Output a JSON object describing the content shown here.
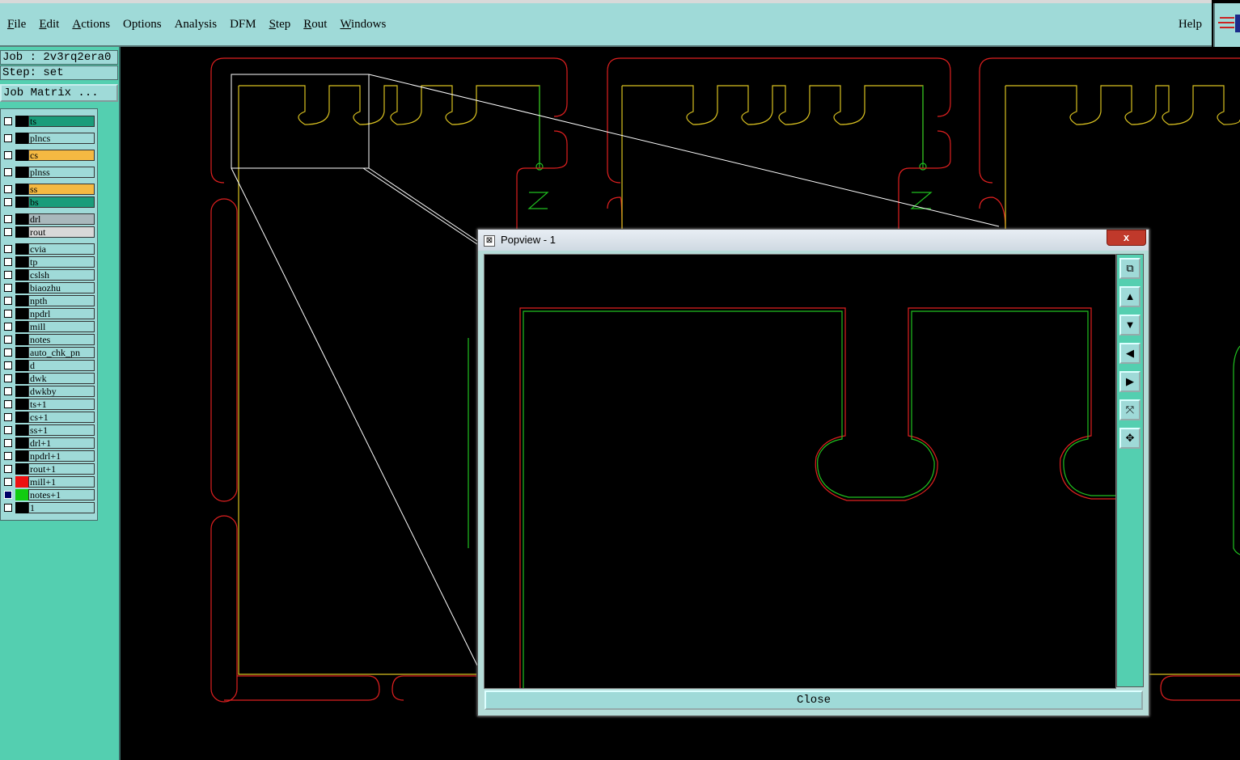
{
  "menu": {
    "items": [
      "File",
      "Edit",
      "Actions",
      "Options",
      "Analysis",
      "DFM",
      "Step",
      "Rout",
      "Windows"
    ],
    "help": "Help"
  },
  "job": {
    "label": "Job : 2v3rq2era0",
    "step": "Step: set",
    "matrix_button": "Job Matrix ..."
  },
  "layers": [
    {
      "name": "ts",
      "color": "#1a9c7a"
    },
    {
      "name": "plncs",
      "color": "#9fdad8"
    },
    {
      "name": "cs",
      "color": "#f5b942"
    },
    {
      "name": "plnss",
      "color": "#9fdad8"
    },
    {
      "name": "ss",
      "color": "#f5b942"
    },
    {
      "name": "bs",
      "color": "#1a9c7a"
    },
    {
      "name": "drl",
      "color": "#a9b8bc"
    },
    {
      "name": "rout",
      "color": "#d8d8d8"
    },
    {
      "name": "cvia",
      "color": "#9fdad8"
    },
    {
      "name": "tp",
      "color": "#9fdad8"
    },
    {
      "name": "cslsh",
      "color": "#9fdad8"
    },
    {
      "name": "biaozhu",
      "color": "#9fdad8"
    },
    {
      "name": "npth",
      "color": "#9fdad8"
    },
    {
      "name": "npdrl",
      "color": "#9fdad8"
    },
    {
      "name": "mill",
      "color": "#9fdad8"
    },
    {
      "name": "notes",
      "color": "#9fdad8"
    },
    {
      "name": "auto_chk_pn",
      "color": "#9fdad8"
    },
    {
      "name": "d",
      "color": "#9fdad8"
    },
    {
      "name": "dwk",
      "color": "#9fdad8"
    },
    {
      "name": "dwkby",
      "color": "#9fdad8"
    },
    {
      "name": "ts+1",
      "color": "#9fdad8"
    },
    {
      "name": "cs+1",
      "color": "#9fdad8"
    },
    {
      "name": "ss+1",
      "color": "#9fdad8"
    },
    {
      "name": "drl+1",
      "color": "#9fdad8"
    },
    {
      "name": "npdrl+1",
      "color": "#9fdad8"
    },
    {
      "name": "rout+1",
      "color": "#9fdad8"
    },
    {
      "name": "mill+1",
      "color": "#9fdad8",
      "swatch": "#e11"
    },
    {
      "name": "notes+1",
      "color": "#9fdad8",
      "swatch": "#1c1",
      "selected": true
    },
    {
      "name": "1",
      "color": "#9fdad8"
    }
  ],
  "popview": {
    "title": "Popview - 1",
    "close_label": "Close",
    "close_x": "x"
  },
  "colors": {
    "menu_bg": "#9fdad8",
    "panel_bg": "#54cfb0",
    "outline_red": "#e02020",
    "outline_green": "#20c020",
    "outline_yellow": "#d8c020"
  }
}
